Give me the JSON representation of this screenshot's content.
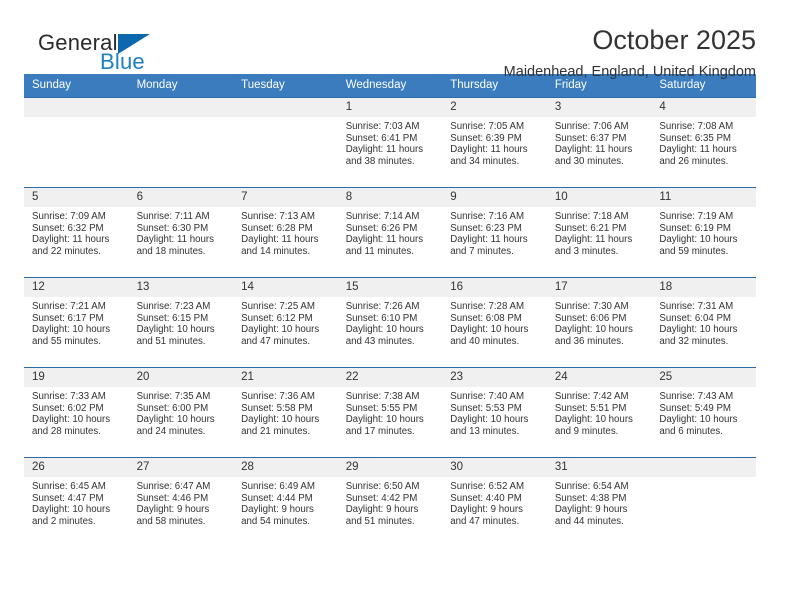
{
  "brand": {
    "name_part1": "General",
    "name_part2": "Blue",
    "triangle_color": "#0d68ad",
    "accent_color": "#1f7fc4"
  },
  "header": {
    "month_title": "October 2025",
    "location": "Maidenhead, England, United Kingdom"
  },
  "theme": {
    "header_row_bg": "#3a7cbe",
    "header_row_text": "#ffffff",
    "row_divider": "#2a6aa8",
    "daynum_bg": "#f0f0f0",
    "body_text": "#333333"
  },
  "calendar": {
    "weekday_headers": [
      "Sunday",
      "Monday",
      "Tuesday",
      "Wednesday",
      "Thursday",
      "Friday",
      "Saturday"
    ],
    "weeks": [
      [
        {
          "day": "",
          "empty": true
        },
        {
          "day": "",
          "empty": true
        },
        {
          "day": "",
          "empty": true
        },
        {
          "day": "1",
          "sunrise": "Sunrise: 7:03 AM",
          "sunset": "Sunset: 6:41 PM",
          "daylight_1": "Daylight: 11 hours",
          "daylight_2": "and 38 minutes."
        },
        {
          "day": "2",
          "sunrise": "Sunrise: 7:05 AM",
          "sunset": "Sunset: 6:39 PM",
          "daylight_1": "Daylight: 11 hours",
          "daylight_2": "and 34 minutes."
        },
        {
          "day": "3",
          "sunrise": "Sunrise: 7:06 AM",
          "sunset": "Sunset: 6:37 PM",
          "daylight_1": "Daylight: 11 hours",
          "daylight_2": "and 30 minutes."
        },
        {
          "day": "4",
          "sunrise": "Sunrise: 7:08 AM",
          "sunset": "Sunset: 6:35 PM",
          "daylight_1": "Daylight: 11 hours",
          "daylight_2": "and 26 minutes."
        }
      ],
      [
        {
          "day": "5",
          "sunrise": "Sunrise: 7:09 AM",
          "sunset": "Sunset: 6:32 PM",
          "daylight_1": "Daylight: 11 hours",
          "daylight_2": "and 22 minutes."
        },
        {
          "day": "6",
          "sunrise": "Sunrise: 7:11 AM",
          "sunset": "Sunset: 6:30 PM",
          "daylight_1": "Daylight: 11 hours",
          "daylight_2": "and 18 minutes."
        },
        {
          "day": "7",
          "sunrise": "Sunrise: 7:13 AM",
          "sunset": "Sunset: 6:28 PM",
          "daylight_1": "Daylight: 11 hours",
          "daylight_2": "and 14 minutes."
        },
        {
          "day": "8",
          "sunrise": "Sunrise: 7:14 AM",
          "sunset": "Sunset: 6:26 PM",
          "daylight_1": "Daylight: 11 hours",
          "daylight_2": "and 11 minutes."
        },
        {
          "day": "9",
          "sunrise": "Sunrise: 7:16 AM",
          "sunset": "Sunset: 6:23 PM",
          "daylight_1": "Daylight: 11 hours",
          "daylight_2": "and 7 minutes."
        },
        {
          "day": "10",
          "sunrise": "Sunrise: 7:18 AM",
          "sunset": "Sunset: 6:21 PM",
          "daylight_1": "Daylight: 11 hours",
          "daylight_2": "and 3 minutes."
        },
        {
          "day": "11",
          "sunrise": "Sunrise: 7:19 AM",
          "sunset": "Sunset: 6:19 PM",
          "daylight_1": "Daylight: 10 hours",
          "daylight_2": "and 59 minutes."
        }
      ],
      [
        {
          "day": "12",
          "sunrise": "Sunrise: 7:21 AM",
          "sunset": "Sunset: 6:17 PM",
          "daylight_1": "Daylight: 10 hours",
          "daylight_2": "and 55 minutes."
        },
        {
          "day": "13",
          "sunrise": "Sunrise: 7:23 AM",
          "sunset": "Sunset: 6:15 PM",
          "daylight_1": "Daylight: 10 hours",
          "daylight_2": "and 51 minutes."
        },
        {
          "day": "14",
          "sunrise": "Sunrise: 7:25 AM",
          "sunset": "Sunset: 6:12 PM",
          "daylight_1": "Daylight: 10 hours",
          "daylight_2": "and 47 minutes."
        },
        {
          "day": "15",
          "sunrise": "Sunrise: 7:26 AM",
          "sunset": "Sunset: 6:10 PM",
          "daylight_1": "Daylight: 10 hours",
          "daylight_2": "and 43 minutes."
        },
        {
          "day": "16",
          "sunrise": "Sunrise: 7:28 AM",
          "sunset": "Sunset: 6:08 PM",
          "daylight_1": "Daylight: 10 hours",
          "daylight_2": "and 40 minutes."
        },
        {
          "day": "17",
          "sunrise": "Sunrise: 7:30 AM",
          "sunset": "Sunset: 6:06 PM",
          "daylight_1": "Daylight: 10 hours",
          "daylight_2": "and 36 minutes."
        },
        {
          "day": "18",
          "sunrise": "Sunrise: 7:31 AM",
          "sunset": "Sunset: 6:04 PM",
          "daylight_1": "Daylight: 10 hours",
          "daylight_2": "and 32 minutes."
        }
      ],
      [
        {
          "day": "19",
          "sunrise": "Sunrise: 7:33 AM",
          "sunset": "Sunset: 6:02 PM",
          "daylight_1": "Daylight: 10 hours",
          "daylight_2": "and 28 minutes."
        },
        {
          "day": "20",
          "sunrise": "Sunrise: 7:35 AM",
          "sunset": "Sunset: 6:00 PM",
          "daylight_1": "Daylight: 10 hours",
          "daylight_2": "and 24 minutes."
        },
        {
          "day": "21",
          "sunrise": "Sunrise: 7:36 AM",
          "sunset": "Sunset: 5:58 PM",
          "daylight_1": "Daylight: 10 hours",
          "daylight_2": "and 21 minutes."
        },
        {
          "day": "22",
          "sunrise": "Sunrise: 7:38 AM",
          "sunset": "Sunset: 5:55 PM",
          "daylight_1": "Daylight: 10 hours",
          "daylight_2": "and 17 minutes."
        },
        {
          "day": "23",
          "sunrise": "Sunrise: 7:40 AM",
          "sunset": "Sunset: 5:53 PM",
          "daylight_1": "Daylight: 10 hours",
          "daylight_2": "and 13 minutes."
        },
        {
          "day": "24",
          "sunrise": "Sunrise: 7:42 AM",
          "sunset": "Sunset: 5:51 PM",
          "daylight_1": "Daylight: 10 hours",
          "daylight_2": "and 9 minutes."
        },
        {
          "day": "25",
          "sunrise": "Sunrise: 7:43 AM",
          "sunset": "Sunset: 5:49 PM",
          "daylight_1": "Daylight: 10 hours",
          "daylight_2": "and 6 minutes."
        }
      ],
      [
        {
          "day": "26",
          "sunrise": "Sunrise: 6:45 AM",
          "sunset": "Sunset: 4:47 PM",
          "daylight_1": "Daylight: 10 hours",
          "daylight_2": "and 2 minutes."
        },
        {
          "day": "27",
          "sunrise": "Sunrise: 6:47 AM",
          "sunset": "Sunset: 4:46 PM",
          "daylight_1": "Daylight: 9 hours",
          "daylight_2": "and 58 minutes."
        },
        {
          "day": "28",
          "sunrise": "Sunrise: 6:49 AM",
          "sunset": "Sunset: 4:44 PM",
          "daylight_1": "Daylight: 9 hours",
          "daylight_2": "and 54 minutes."
        },
        {
          "day": "29",
          "sunrise": "Sunrise: 6:50 AM",
          "sunset": "Sunset: 4:42 PM",
          "daylight_1": "Daylight: 9 hours",
          "daylight_2": "and 51 minutes."
        },
        {
          "day": "30",
          "sunrise": "Sunrise: 6:52 AM",
          "sunset": "Sunset: 4:40 PM",
          "daylight_1": "Daylight: 9 hours",
          "daylight_2": "and 47 minutes."
        },
        {
          "day": "31",
          "sunrise": "Sunrise: 6:54 AM",
          "sunset": "Sunset: 4:38 PM",
          "daylight_1": "Daylight: 9 hours",
          "daylight_2": "and 44 minutes."
        },
        {
          "day": "",
          "empty": true
        }
      ]
    ]
  }
}
